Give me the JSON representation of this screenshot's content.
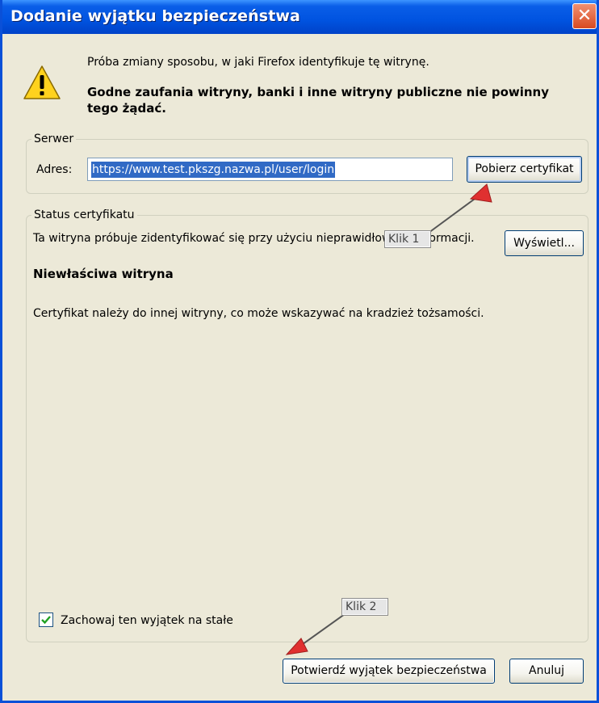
{
  "window": {
    "title": "Dodanie wyjątku bezpieczeństwa",
    "close_glyph": "✕"
  },
  "warning": {
    "icon": "warning-icon",
    "line1": "Próba zmiany sposobu, w jaki Firefox identyfikuje tę witrynę.",
    "line2": "Godne zaufania witryny, banki i inne witryny publiczne nie powinny tego żądać."
  },
  "server": {
    "legend": "Serwer",
    "address_label": "Adres:",
    "address_value": "https://www.test.pkszg.nazwa.pl/user/login",
    "fetch_button": "Pobierz certyfikat"
  },
  "status": {
    "legend": "Status certyfikatu",
    "description": "Ta witryna próbuje zidentyfikować się przy użyciu nieprawidłowych informacji.",
    "view_button": "Wyświetl...",
    "problem_title": "Niewłaściwa witryna",
    "problem_detail": "Certyfikat należy do innej witryny, co może wskazywać na kradzież tożsamości."
  },
  "options": {
    "permanent_label": "Zachowaj ten wyjątek na stałe",
    "permanent_checked": true
  },
  "footer": {
    "confirm_button": "Potwierdź wyjątek bezpieczeństwa",
    "cancel_button": "Anuluj"
  },
  "annotations": {
    "step1": "Klik 1",
    "step2": "Klik 2",
    "arrow_color": "#e03030"
  },
  "colors": {
    "titlebar": "#0053e0",
    "dialog_bg": "#ece9d8",
    "selection": "#316ac5"
  }
}
